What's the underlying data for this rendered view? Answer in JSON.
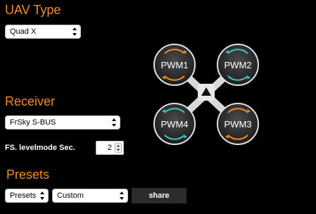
{
  "uav_type": {
    "title": "UAV Type",
    "selected": "Quad X"
  },
  "receiver": {
    "title": "Receiver",
    "selected": "FrSky S-BUS",
    "failsafe_label": "FS. levelmode Sec.",
    "failsafe_value": "2"
  },
  "presets": {
    "title": "Presets",
    "presets_select": "Presets",
    "custom_select": "Custom",
    "share_label": "share"
  },
  "diagram": {
    "motors": [
      {
        "label": "PWM1",
        "rotation": "clockwise",
        "color": "#f08a24"
      },
      {
        "label": "PWM2",
        "rotation": "counter-clockwise",
        "color": "#3ec6c6"
      },
      {
        "label": "PWM4",
        "rotation": "counter-clockwise",
        "color": "#3ec6c6"
      },
      {
        "label": "PWM3",
        "rotation": "clockwise",
        "color": "#f08a24"
      }
    ],
    "front_marker": "up-triangle-icon"
  },
  "colors": {
    "accent": "#f08a24",
    "cw": "#f08a24",
    "ccw": "#3ec6c6",
    "background": "#000000"
  }
}
